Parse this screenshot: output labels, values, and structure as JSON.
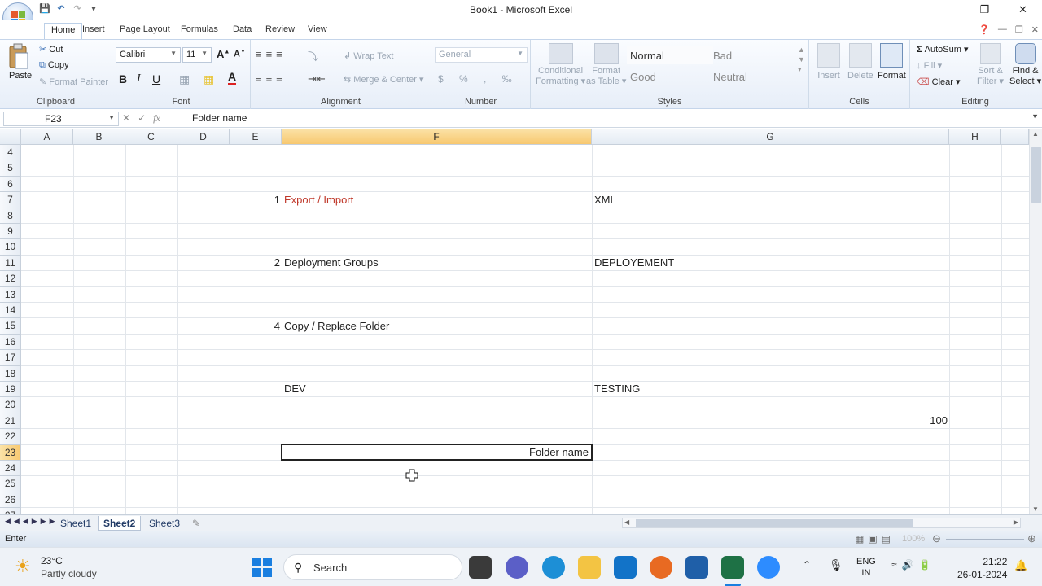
{
  "window": {
    "title": "Book1 - Microsoft Excel"
  },
  "ribbon_tabs": [
    "Home",
    "Insert",
    "Page Layout",
    "Formulas",
    "Data",
    "Review",
    "View"
  ],
  "clipboard": {
    "paste": "Paste",
    "cut": "Cut",
    "copy": "Copy",
    "format_painter": "Format Painter",
    "label": "Clipboard"
  },
  "font": {
    "name": "Calibri",
    "size": "11",
    "label": "Font"
  },
  "alignment": {
    "wrap": "Wrap Text",
    "merge": "Merge & Center",
    "label": "Alignment"
  },
  "number": {
    "format": "General",
    "label": "Number"
  },
  "styles": {
    "conditional": "Conditional",
    "formatting": "Formatting",
    "format_as": "Format",
    "as_table": "as Table",
    "normal": "Normal",
    "bad": "Bad",
    "good": "Good",
    "neutral": "Neutral",
    "label": "Styles"
  },
  "cells": {
    "insert": "Insert",
    "delete": "Delete",
    "format": "Format",
    "label": "Cells"
  },
  "editing": {
    "autosum": "AutoSum",
    "fill": "Fill",
    "clear": "Clear",
    "sort": "Sort &",
    "filter": "Filter",
    "find": "Find &",
    "select": "Select",
    "label": "Editing"
  },
  "formula_bar": {
    "name_box": "F23",
    "content": "Folder name"
  },
  "columns": [
    "A",
    "B",
    "C",
    "D",
    "E",
    "F",
    "G",
    "H"
  ],
  "rows": [
    "4",
    "5",
    "6",
    "7",
    "8",
    "9",
    "10",
    "11",
    "12",
    "13",
    "14",
    "15",
    "16",
    "17",
    "18",
    "19",
    "20",
    "21",
    "22",
    "23",
    "24",
    "25",
    "26",
    "27"
  ],
  "cells_data": {
    "e7": "1",
    "f7": "Export / Import",
    "g7": "XML",
    "e11": "2",
    "f11": "Deployment Groups",
    "g11": "DEPLOYEMENT",
    "e15": "4",
    "f15": "Copy / Replace Folder",
    "f19": "DEV",
    "g19": "TESTING",
    "h21": "100",
    "f23": "Folder name"
  },
  "sheets": [
    "Sheet1",
    "Sheet2",
    "Sheet3"
  ],
  "status": {
    "mode": "Enter",
    "zoom": "100%"
  },
  "taskbar": {
    "temp": "23°C",
    "weather": "Partly cloudy",
    "search": "Search",
    "lang1": "ENG",
    "lang2": "IN",
    "time": "21:22",
    "date": "26-01-2024"
  },
  "colors": {
    "accent_red": "#c0392b",
    "selected_header": "#f7c870"
  }
}
